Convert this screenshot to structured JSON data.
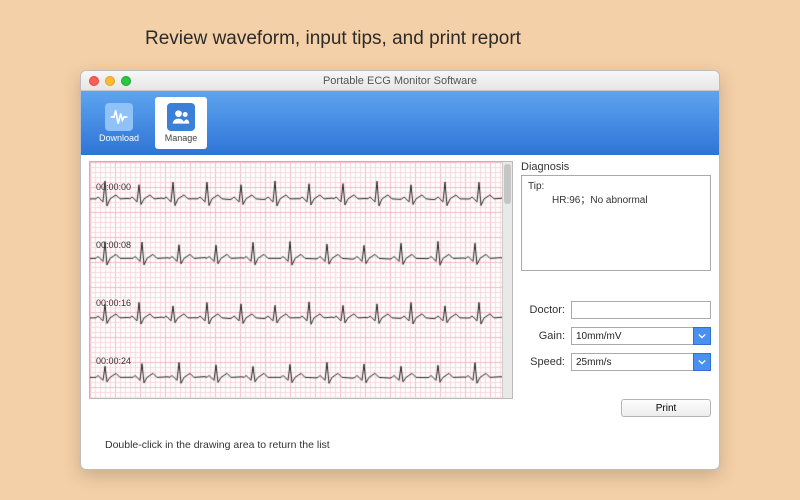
{
  "headline": "Review waveform, input tips, and print report",
  "window": {
    "title": "Portable ECG Monitor Software"
  },
  "toolbar": {
    "download": {
      "label": "Download"
    },
    "manage": {
      "label": "Manage"
    }
  },
  "ecg": {
    "timestamps": [
      "00:00:00",
      "00:00:08",
      "00:00:16",
      "00:00:24"
    ]
  },
  "diagnosis": {
    "section_label": "Diagnosis",
    "tip_label": "Tip:",
    "tip_text": "HR:96；No abnormal"
  },
  "fields": {
    "doctor_label": "Doctor:",
    "doctor_value": "",
    "gain_label": "Gain:",
    "gain_value": "10mm/mV",
    "speed_label": "Speed:",
    "speed_value": "25mm/s"
  },
  "print_label": "Print",
  "hint": "Double-click in the drawing area to return the list",
  "colors": {
    "grid_minor": "#f7d7dd",
    "grid_major": "#f3b9c4",
    "wave": "#222"
  }
}
